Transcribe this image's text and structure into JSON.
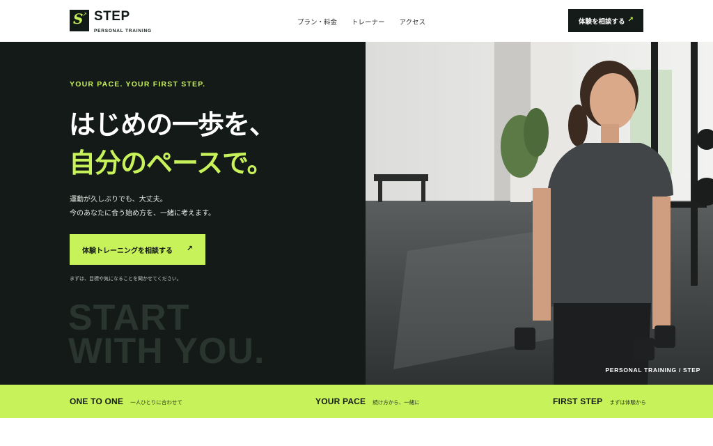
{
  "brand": {
    "name": "STEP",
    "tagline": "PERSONAL TRAINING",
    "mark_letter": "S"
  },
  "nav": {
    "items": [
      "プラン・料金",
      "トレーナー",
      "アクセス"
    ]
  },
  "header_cta": {
    "label": "体験を相談する",
    "arrow": "↗"
  },
  "hero": {
    "eyebrow": "YOUR PACE. YOUR FIRST STEP.",
    "headline_line1": "はじめの一歩を、",
    "headline_line2": "自分のペースで。",
    "lead_line1": "運動が久しぶりでも、大丈夫。",
    "lead_line2": "今のあなたに合う始め方を、一緒に考えます。",
    "cta_label": "体験トレーニングを相談する",
    "cta_arrow": "↗",
    "note": "まずは、目標や気になることを聞かせてください。",
    "big_line1": "START",
    "big_line2": "WITH YOU.",
    "photo_caption": "PERSONAL TRAINING / STEP"
  },
  "strip": [
    {
      "title": "ONE TO ONE",
      "sub": "一人ひとりに合わせて"
    },
    {
      "title": "YOUR PACE",
      "sub": "続け方から、一緒に"
    },
    {
      "title": "FIRST STEP",
      "sub": "まずは体験から"
    }
  ],
  "colors": {
    "accent": "#c8f25a",
    "dark": "#141a17",
    "white": "#ffffff"
  }
}
